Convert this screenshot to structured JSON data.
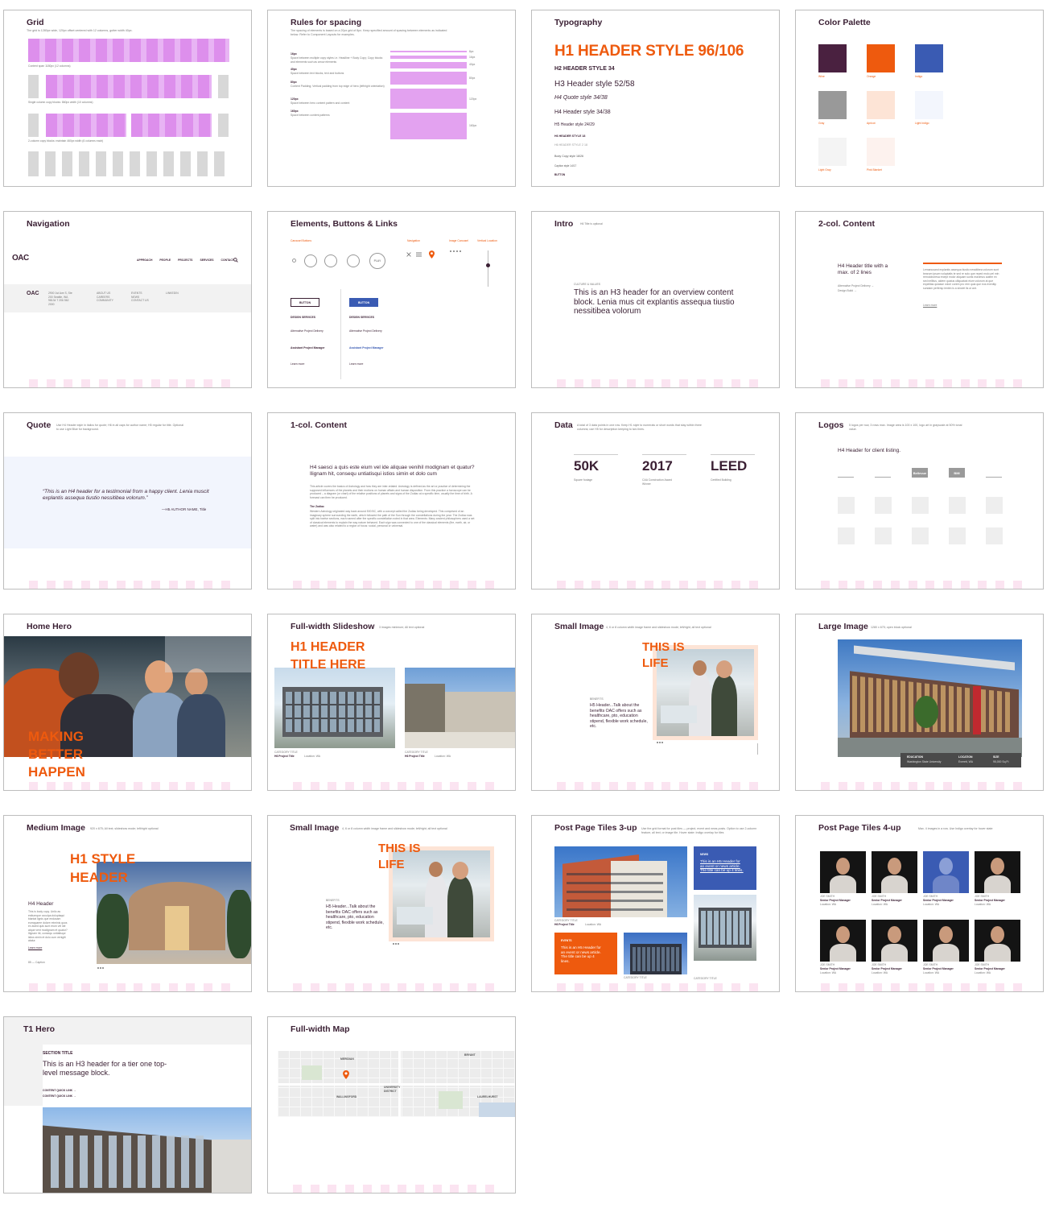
{
  "cards": {
    "grid": {
      "title": "Grid",
      "desc": "The grid is 1280px wide, 120px offset centered with 12 columns, gutter width 40px.",
      "captions": [
        "Content span 1180px (12 columns)",
        "Single column copy blocks: 860px width (10 columns)",
        "2-column copy blocks: maintain 460px width (6 columns each)"
      ]
    },
    "spacing": {
      "title": "Rules for spacing",
      "desc": "The spacing of elements is based on a 20px grid of 8px. Keep specified amount of spacing between elements as indicated below. Refer to Component Layouts for examples.",
      "rules": [
        {
          "size": "16px",
          "text": "Space between multiple copy styles i.e. Headline + Body Copy; Copy blocks and elements such as arrow elements"
        },
        {
          "size": "40px",
          "text": "Space between text blocks, text and buttons"
        },
        {
          "size": "80px",
          "text": "Content Padding; Vertical padding from top edge of hero (left/right orientation)"
        },
        {
          "size": "120px",
          "text": "Space between hero content pattern and content"
        },
        {
          "size": "160px",
          "text": "Space between content patterns"
        }
      ],
      "bar_labels": [
        "8px",
        "16px",
        "40px",
        "80px",
        "120px",
        "160px"
      ]
    },
    "typography": {
      "title": "Typography",
      "h1": "H1 HEADER STYLE 96/106",
      "h2": "H2 HEADER STYLE 34",
      "h3": "H3 Header style 52/58",
      "quote": "H4 Quote style 34/38",
      "h4": "H4 Header style 34/38",
      "h5": "H5 Header style 24/29",
      "h6": "H6 HEADER STYLE 18",
      "h6b": "H6 HEADER STYLE 2 18",
      "body": "Body Copy style 18/26",
      "caption": "Caption style 14/17",
      "button": "BUTTON"
    },
    "palette": {
      "title": "Color Palette",
      "swatches": [
        {
          "name": "Wine",
          "color": "#4a2140"
        },
        {
          "name": "Orange",
          "color": "#ee5a0e"
        },
        {
          "name": "Indigo",
          "color": "#3a5bb3"
        },
        {
          "name": "Gray",
          "color": "#999999"
        },
        {
          "name": "Apricot",
          "color": "#fde4d6"
        },
        {
          "name": "Light Indigo",
          "color": "#f3f6fd"
        },
        {
          "name": "Light Gray",
          "color": "#f4f4f4"
        },
        {
          "name": "Pink Blanket",
          "color": "#fdf2ee"
        }
      ]
    },
    "navigation": {
      "title": "Navigation",
      "logo": "OAC",
      "menu": [
        "APPROACH",
        "PEOPLE",
        "PROJECTS",
        "SERVICES",
        "CONTACT"
      ],
      "footer_logo": "OAC",
      "footer_cols": [
        "2900 1st Ave S, Ste 200 Seattle, WA 98134 T 206 562 2000",
        "ABOUT US CAREERS COMMUNITY",
        "EVENTS NEWS CONTACT US",
        "LINKEDIN"
      ]
    },
    "elements": {
      "title": "Elements, Buttons & Links",
      "button": "BUTTON",
      "button2": "BUTTON",
      "design": "DESIGN SERVICES",
      "design2": "DESIGN SERVICES",
      "apd": "Alternative Project Delivery",
      "apd2": "Alternative Project Delivery",
      "apm": "Assistant Project Manager",
      "apm2": "Assistant Project Manager",
      "learn": "Learn more",
      "learn2": "Learn more",
      "play": "PLAY",
      "labels": [
        "Carousel Buttons",
        "Navigation",
        "Image Carousel",
        "Vertical Location"
      ]
    },
    "intro": {
      "title": "Intro",
      "note": "H6 Title is optional",
      "eyebrow": "CULTURE & VALUES",
      "text": "This is an H3 header for an overview content block. Lenia mus cit explantis assequa tiustio nessitibea volorum"
    },
    "twocol": {
      "title": "2-col. Content",
      "h4": "H4 Header title with a max. of 2 lines",
      "links": [
        "Alternative Project Delivery →",
        "Design Build →"
      ],
      "body": "Lemanusand explantis assequa tiustio nessitibea volorum sunt bearum ipsum voluptatis te sed re solo que reped molo pel min remoloboresa recept molor aliquam sunts maximus autem ex sed nellitus, aidem quatus ulliquatust eium volorum at que expelitas quiasse volori corem pro rem quia que eos evenitip sundam perfersp ientim is a sinciet lis ut ant.",
      "learn": "Learn more"
    },
    "quote": {
      "title": "Quote",
      "desc": "Use H4 Header style in italics for quote; H6 in all caps for author name; H5 regular for title. Optional to use Light Blue for background.",
      "text": "“This is an H4 header for a testimonial from a happy client. Lenia muscit explantis assequa tiustio nessitibea volorum.”",
      "author": "—H5 AUTHOR NAME, Title"
    },
    "onecol": {
      "title": "1-col. Content",
      "h4": "H4 saesci a quis este eium vel ide aliquae venihil modignam et quatur? Ilignam hit, consequ untiatisqui istios simin et dolo cum",
      "p1": "This article covers the basics of Astrology and how they are inter-related. Astrology is defined as the art or practice of determining the supposed influences of the planets and their motions on human affairs and human disposition. From this practice a horoscope can be produced – a diagram (or chart) of the relative positions of planets and signs of the Zodiac at a specific time, usually the time of birth. A forecast can then be produced.",
      "sub": "The Zodiac",
      "p2": "Western Astrology originated way back around 500 BC, with a concept called the Zodiac being developed. This comprised of an imaginary sphere surrounding the earth, which followed the path of the Sun through the constellations during the year. The Zodiac was split into twelve sections, each named after the specific constellation noted in that area. Elements: Many ancient philosophers used a set of classical elements to explain the way nature behaved. Each sign was connected to one of the classical elements (fire, earth, air, or water) and was also related to a region of focus: social, personal or universal."
    },
    "data": {
      "title": "Data",
      "desc": "A total of 3 data points in one row. Keep H1 style to numerals or short words that stay within three columns; use H5 for description keeping to two lines.",
      "stats": [
        {
          "value": "50K",
          "label": "Square footage"
        },
        {
          "value": "2017",
          "label": "CAA Construction Award Winner"
        },
        {
          "value": "LEED",
          "label": "Certified Building"
        }
      ]
    },
    "logos": {
      "title": "Logos",
      "desc": "5 logos per row, 3 rows max. Image area is 100 x 100, logo art in grayscale at 50% tonal value.",
      "h4": "H4 Header for client listing.",
      "logo_texts": [
        "",
        "",
        "Bellevue",
        "BMI",
        ""
      ]
    },
    "homehero": {
      "title": "Home Hero",
      "headline": [
        "MAKING",
        "BETTER",
        "HAPPEN"
      ]
    },
    "slideshow": {
      "title": "Full-width Slideshow",
      "desc": "3 images minimum; All text optional",
      "headline": [
        "H1 HEADER",
        "TITLE HERE"
      ],
      "cat": "CATEGORY TITLE",
      "proj": "H6 Project Title",
      "loc": "Location: WA",
      "cat2": "CATEGORY TITLE",
      "proj2": "H6 Project Title",
      "loc2": "Location: WA"
    },
    "smallimage": {
      "title": "Small Image",
      "desc": "4, 6 or 8 column width image frame and slideshow mode; left/right; all text optional",
      "headline": [
        "THIS IS",
        "LIFE"
      ],
      "eyebrow": "BENEFITS",
      "text": "H5 Header...Talk about the benefits OAC offers such as healthcare, pto, education stipend, flexible work schedule, etc."
    },
    "largeimage": {
      "title": "Large Image",
      "desc": "1280 x 675; open block optional",
      "caption_heads": [
        "EDUCATION",
        "LOCATION",
        "SIZE"
      ],
      "caption_vals": [
        "Washington State University",
        "Everett, WA",
        "95,000 Sq Ft"
      ]
    },
    "mediumimage": {
      "title": "Medium Image",
      "desc": "920 x 675; All text; slideshow mode; left/right optional",
      "headline": [
        "H1 STYLE",
        "HEADER"
      ],
      "h4": "H4 Header",
      "body": "This is body copy. Unilo as esttumque occulpa doluptaqui blantat lignis que endusam eumquaere dolore reiminis quos ex asied quis sunt erum vel ide atque vent modignam et quatur? Ilignam hit, consequ untiatisqui istios simin et dolo cum veniglit atatur.",
      "learn": "Learn more",
      "caption": "85 — Caption"
    },
    "smallimage2": {
      "title": "Small Image",
      "desc": "4, 6 or 8 column width image frame and slideshow mode; left/right; all text optional",
      "headline": [
        "THIS IS",
        "LIFE"
      ],
      "eyebrow": "BENEFITS",
      "text": "H5 Header...Talk about the benefits OAC offers such as healthcare, pto, education stipend, flexible work schedule, etc."
    },
    "tiles3": {
      "title": "Post Page Tiles 3-up",
      "desc": "Use the grid format for post tiles — project, event and news posts. Option to use 2-column feature, all text; or image tile. Hover state: Indigo overlay for tiles",
      "news_label": "NEWS",
      "news_text": "This is an H5 Header for an event or news article. The title can be up 4 lines.",
      "events_label": "EVENTS",
      "events_text": "This is an H5 Header for an event or news article. The title can be up 4 lines.",
      "cat": "CATEGORY TITLE",
      "proj": "H6 Project Title",
      "loc": "Location: WA"
    },
    "tiles4": {
      "title": "Post Page Tiles 4-up",
      "desc": "Max. 4 images in a row. Use Indigo overlay for hover state",
      "name": "JOE SMITH",
      "role": "Senior Project Manager",
      "loc": "Location: WA"
    },
    "t1hero": {
      "title": "T1 Hero",
      "section": "SECTION TITLE",
      "text": "This is an H3 header for a tier one top-level message block.",
      "links": [
        "CONTENT QUICK LINK →",
        "CONTENT QUICK LINK →"
      ]
    },
    "map": {
      "title": "Full-width Map",
      "labels": [
        "MERIDIAN",
        "BRYANT",
        "WALLINGFORD",
        "UNIVERSITY DISTRICT",
        "LAURELHURST"
      ]
    }
  }
}
